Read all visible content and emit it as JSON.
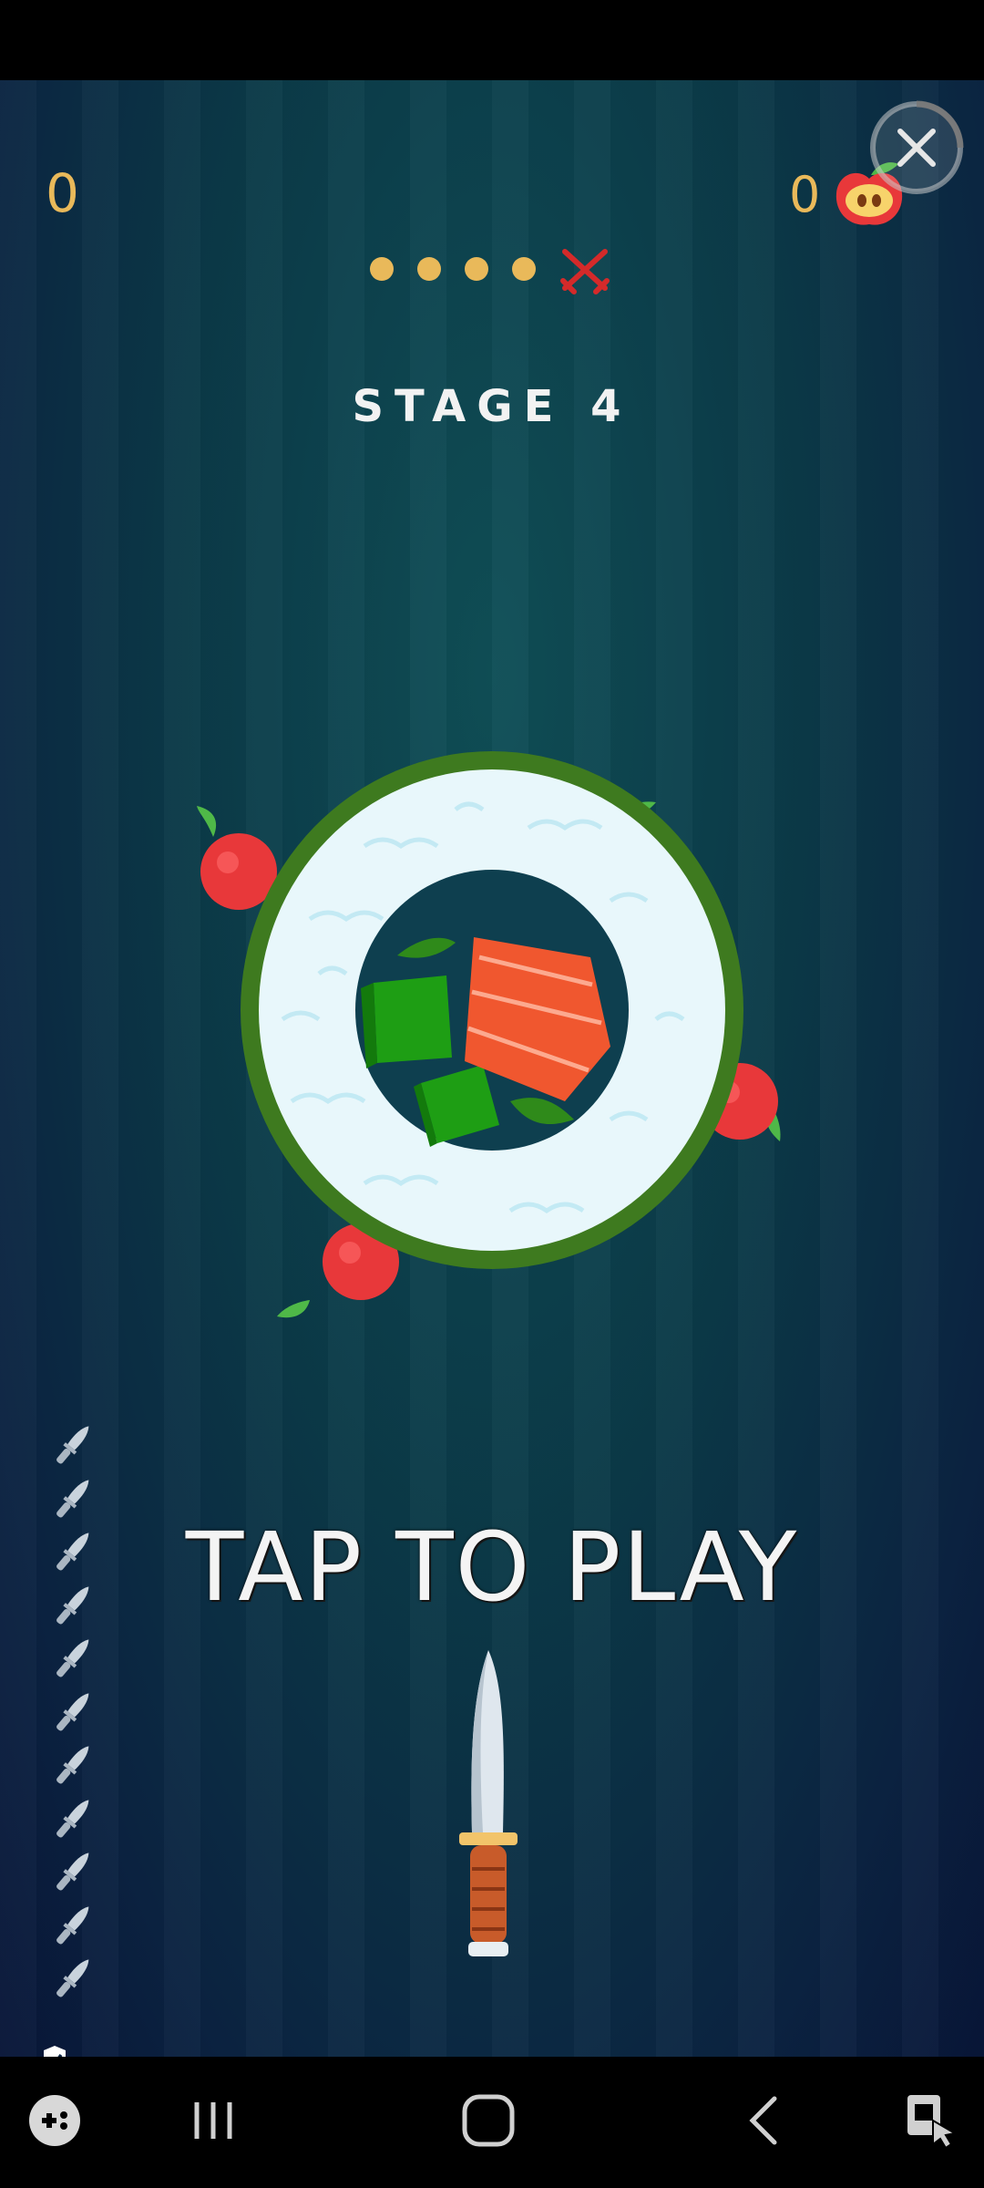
{
  "hud": {
    "score": "0",
    "apple_count": "0"
  },
  "stage": {
    "label": "STAGE 4",
    "completed_dots": 4,
    "boss_icon": "crossed-swords-icon"
  },
  "prompt": {
    "tap_to_play": "TAP TO PLAY"
  },
  "knives_remaining": 11,
  "colors": {
    "accent_gold": "#e9b95a",
    "boss_red": "#d42a2a",
    "apple_red": "#e8383a",
    "nori_green": "#3e7a1f"
  },
  "icons": [
    "close-icon",
    "apple-icon",
    "knife-icon",
    "privacy-hand-icon",
    "game-launcher-icon",
    "recents-icon",
    "home-icon",
    "back-icon",
    "screenshot-touch-icon"
  ]
}
